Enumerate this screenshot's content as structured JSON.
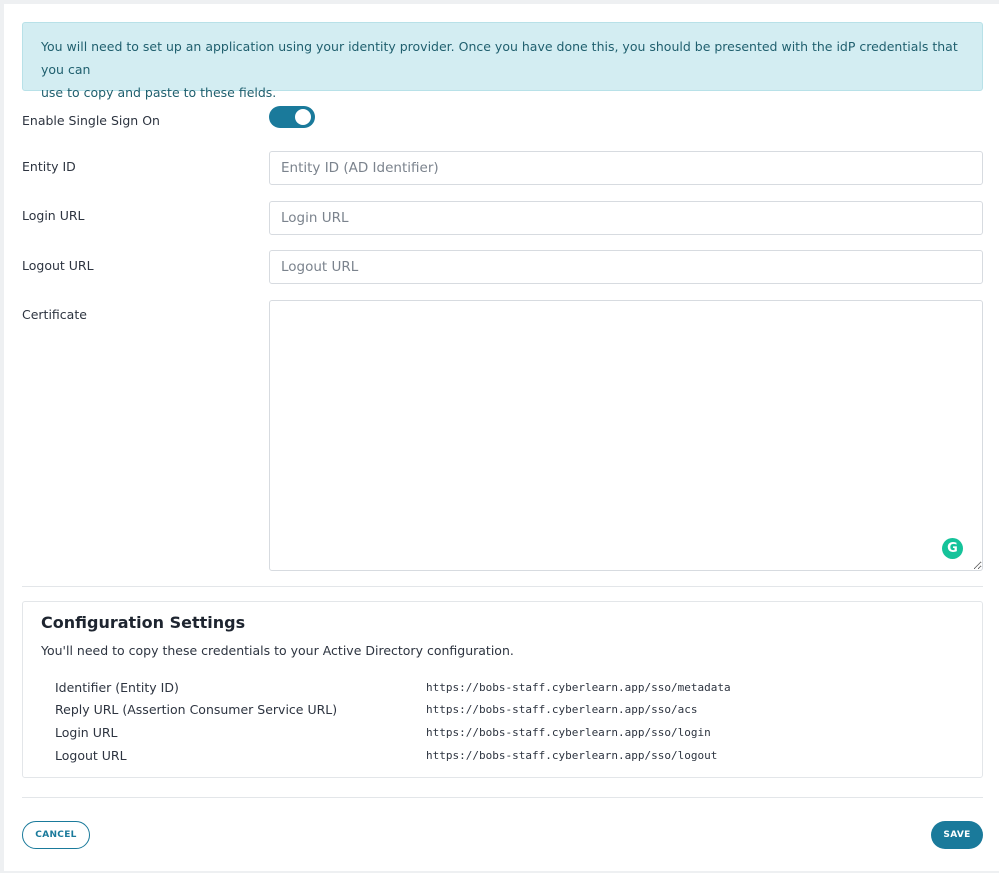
{
  "notice": {
    "line1": "You will need to set up an application using your identity provider. Once you have done this, you should be presented with the idP credentials that you can",
    "line2": "use to copy and paste to these fields."
  },
  "form": {
    "sso_label": "Enable Single Sign On",
    "sso_enabled": true,
    "entity_id": {
      "label": "Entity ID",
      "placeholder": "Entity ID (AD Identifier)",
      "value": ""
    },
    "login_url": {
      "label": "Login URL",
      "placeholder": "Login URL",
      "value": ""
    },
    "logout_url": {
      "label": "Logout URL",
      "placeholder": "Logout URL",
      "value": ""
    },
    "certificate": {
      "label": "Certificate",
      "value": ""
    }
  },
  "config": {
    "title": "Configuration Settings",
    "description": "You'll need to copy these credentials to your Active Directory configuration.",
    "rows": [
      {
        "label": "Identifier (Entity ID)",
        "value": "https://bobs-staff.cyberlearn.app/sso/metadata"
      },
      {
        "label": "Reply URL (Assertion Consumer Service URL)",
        "value": "https://bobs-staff.cyberlearn.app/sso/acs"
      },
      {
        "label": "Login URL",
        "value": "https://bobs-staff.cyberlearn.app/sso/login"
      },
      {
        "label": "Logout URL",
        "value": "https://bobs-staff.cyberlearn.app/sso/logout"
      }
    ]
  },
  "actions": {
    "cancel_label": "CANCEL",
    "save_label": "SAVE"
  },
  "icons": {
    "grammarly": "grammarly-icon",
    "grammarly_glyph": "G"
  },
  "colors": {
    "accent": "#1a7a9b",
    "notice_bg": "#d3edf2",
    "grammarly": "#15c39a"
  }
}
